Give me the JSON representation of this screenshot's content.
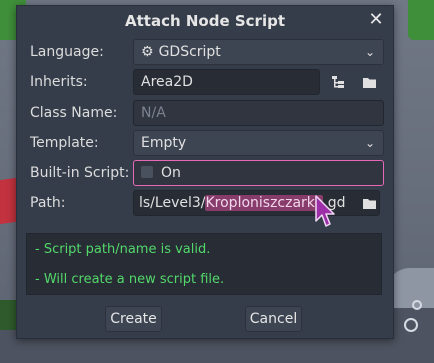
{
  "dialog": {
    "title": "Attach Node Script",
    "close_glyph": "✕"
  },
  "form": {
    "language": {
      "label": "Language:",
      "value": "GDScript",
      "icon": "gear-icon"
    },
    "inherits": {
      "label": "Inherits:",
      "value": "Area2D"
    },
    "class_name": {
      "label": "Class Name:",
      "placeholder": "N/A"
    },
    "template": {
      "label": "Template:",
      "value": "Empty"
    },
    "builtin": {
      "label": "Built-in Script:",
      "checkbox_label": "On",
      "checked": false
    },
    "path": {
      "label": "Path:",
      "value_prefix": "ls/Level3/",
      "value_selected": "Kroploniszczarka",
      "value_suffix": ".gd"
    }
  },
  "status": {
    "lines": [
      "- Script path/name is valid.",
      "- Will create a new script file."
    ]
  },
  "buttons": {
    "create": "Create",
    "cancel": "Cancel"
  },
  "colors": {
    "accent_pink": "#e569b6",
    "status_green": "#53d86a",
    "dialog_bg": "#363d4a",
    "selection": "#873c6c"
  }
}
